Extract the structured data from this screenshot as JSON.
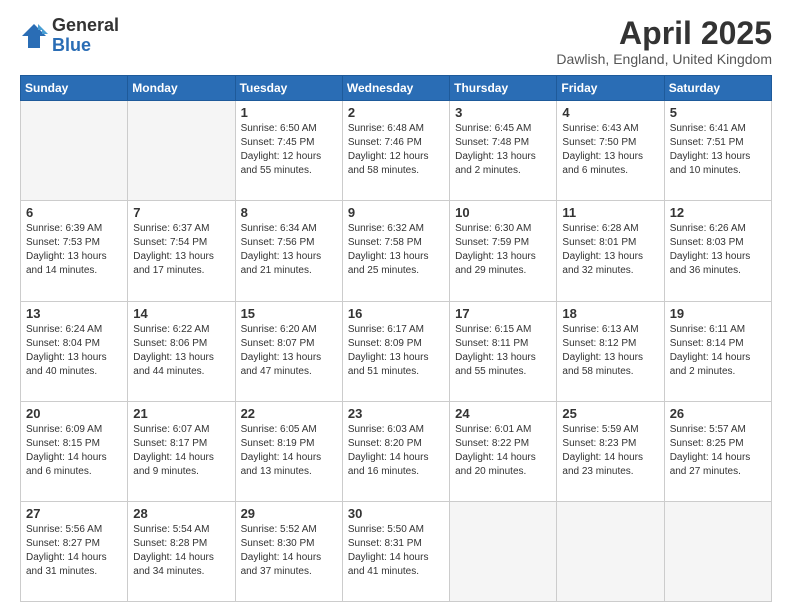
{
  "logo": {
    "general": "General",
    "blue": "Blue"
  },
  "header": {
    "month": "April 2025",
    "location": "Dawlish, England, United Kingdom"
  },
  "weekdays": [
    "Sunday",
    "Monday",
    "Tuesday",
    "Wednesday",
    "Thursday",
    "Friday",
    "Saturday"
  ],
  "weeks": [
    [
      {
        "day": "",
        "empty": true
      },
      {
        "day": "",
        "empty": true
      },
      {
        "day": "1",
        "sunrise": "Sunrise: 6:50 AM",
        "sunset": "Sunset: 7:45 PM",
        "daylight": "Daylight: 12 hours and 55 minutes."
      },
      {
        "day": "2",
        "sunrise": "Sunrise: 6:48 AM",
        "sunset": "Sunset: 7:46 PM",
        "daylight": "Daylight: 12 hours and 58 minutes."
      },
      {
        "day": "3",
        "sunrise": "Sunrise: 6:45 AM",
        "sunset": "Sunset: 7:48 PM",
        "daylight": "Daylight: 13 hours and 2 minutes."
      },
      {
        "day": "4",
        "sunrise": "Sunrise: 6:43 AM",
        "sunset": "Sunset: 7:50 PM",
        "daylight": "Daylight: 13 hours and 6 minutes."
      },
      {
        "day": "5",
        "sunrise": "Sunrise: 6:41 AM",
        "sunset": "Sunset: 7:51 PM",
        "daylight": "Daylight: 13 hours and 10 minutes."
      }
    ],
    [
      {
        "day": "6",
        "sunrise": "Sunrise: 6:39 AM",
        "sunset": "Sunset: 7:53 PM",
        "daylight": "Daylight: 13 hours and 14 minutes."
      },
      {
        "day": "7",
        "sunrise": "Sunrise: 6:37 AM",
        "sunset": "Sunset: 7:54 PM",
        "daylight": "Daylight: 13 hours and 17 minutes."
      },
      {
        "day": "8",
        "sunrise": "Sunrise: 6:34 AM",
        "sunset": "Sunset: 7:56 PM",
        "daylight": "Daylight: 13 hours and 21 minutes."
      },
      {
        "day": "9",
        "sunrise": "Sunrise: 6:32 AM",
        "sunset": "Sunset: 7:58 PM",
        "daylight": "Daylight: 13 hours and 25 minutes."
      },
      {
        "day": "10",
        "sunrise": "Sunrise: 6:30 AM",
        "sunset": "Sunset: 7:59 PM",
        "daylight": "Daylight: 13 hours and 29 minutes."
      },
      {
        "day": "11",
        "sunrise": "Sunrise: 6:28 AM",
        "sunset": "Sunset: 8:01 PM",
        "daylight": "Daylight: 13 hours and 32 minutes."
      },
      {
        "day": "12",
        "sunrise": "Sunrise: 6:26 AM",
        "sunset": "Sunset: 8:03 PM",
        "daylight": "Daylight: 13 hours and 36 minutes."
      }
    ],
    [
      {
        "day": "13",
        "sunrise": "Sunrise: 6:24 AM",
        "sunset": "Sunset: 8:04 PM",
        "daylight": "Daylight: 13 hours and 40 minutes."
      },
      {
        "day": "14",
        "sunrise": "Sunrise: 6:22 AM",
        "sunset": "Sunset: 8:06 PM",
        "daylight": "Daylight: 13 hours and 44 minutes."
      },
      {
        "day": "15",
        "sunrise": "Sunrise: 6:20 AM",
        "sunset": "Sunset: 8:07 PM",
        "daylight": "Daylight: 13 hours and 47 minutes."
      },
      {
        "day": "16",
        "sunrise": "Sunrise: 6:17 AM",
        "sunset": "Sunset: 8:09 PM",
        "daylight": "Daylight: 13 hours and 51 minutes."
      },
      {
        "day": "17",
        "sunrise": "Sunrise: 6:15 AM",
        "sunset": "Sunset: 8:11 PM",
        "daylight": "Daylight: 13 hours and 55 minutes."
      },
      {
        "day": "18",
        "sunrise": "Sunrise: 6:13 AM",
        "sunset": "Sunset: 8:12 PM",
        "daylight": "Daylight: 13 hours and 58 minutes."
      },
      {
        "day": "19",
        "sunrise": "Sunrise: 6:11 AM",
        "sunset": "Sunset: 8:14 PM",
        "daylight": "Daylight: 14 hours and 2 minutes."
      }
    ],
    [
      {
        "day": "20",
        "sunrise": "Sunrise: 6:09 AM",
        "sunset": "Sunset: 8:15 PM",
        "daylight": "Daylight: 14 hours and 6 minutes."
      },
      {
        "day": "21",
        "sunrise": "Sunrise: 6:07 AM",
        "sunset": "Sunset: 8:17 PM",
        "daylight": "Daylight: 14 hours and 9 minutes."
      },
      {
        "day": "22",
        "sunrise": "Sunrise: 6:05 AM",
        "sunset": "Sunset: 8:19 PM",
        "daylight": "Daylight: 14 hours and 13 minutes."
      },
      {
        "day": "23",
        "sunrise": "Sunrise: 6:03 AM",
        "sunset": "Sunset: 8:20 PM",
        "daylight": "Daylight: 14 hours and 16 minutes."
      },
      {
        "day": "24",
        "sunrise": "Sunrise: 6:01 AM",
        "sunset": "Sunset: 8:22 PM",
        "daylight": "Daylight: 14 hours and 20 minutes."
      },
      {
        "day": "25",
        "sunrise": "Sunrise: 5:59 AM",
        "sunset": "Sunset: 8:23 PM",
        "daylight": "Daylight: 14 hours and 23 minutes."
      },
      {
        "day": "26",
        "sunrise": "Sunrise: 5:57 AM",
        "sunset": "Sunset: 8:25 PM",
        "daylight": "Daylight: 14 hours and 27 minutes."
      }
    ],
    [
      {
        "day": "27",
        "sunrise": "Sunrise: 5:56 AM",
        "sunset": "Sunset: 8:27 PM",
        "daylight": "Daylight: 14 hours and 31 minutes."
      },
      {
        "day": "28",
        "sunrise": "Sunrise: 5:54 AM",
        "sunset": "Sunset: 8:28 PM",
        "daylight": "Daylight: 14 hours and 34 minutes."
      },
      {
        "day": "29",
        "sunrise": "Sunrise: 5:52 AM",
        "sunset": "Sunset: 8:30 PM",
        "daylight": "Daylight: 14 hours and 37 minutes."
      },
      {
        "day": "30",
        "sunrise": "Sunrise: 5:50 AM",
        "sunset": "Sunset: 8:31 PM",
        "daylight": "Daylight: 14 hours and 41 minutes."
      },
      {
        "day": "",
        "empty": true
      },
      {
        "day": "",
        "empty": true
      },
      {
        "day": "",
        "empty": true
      }
    ]
  ]
}
